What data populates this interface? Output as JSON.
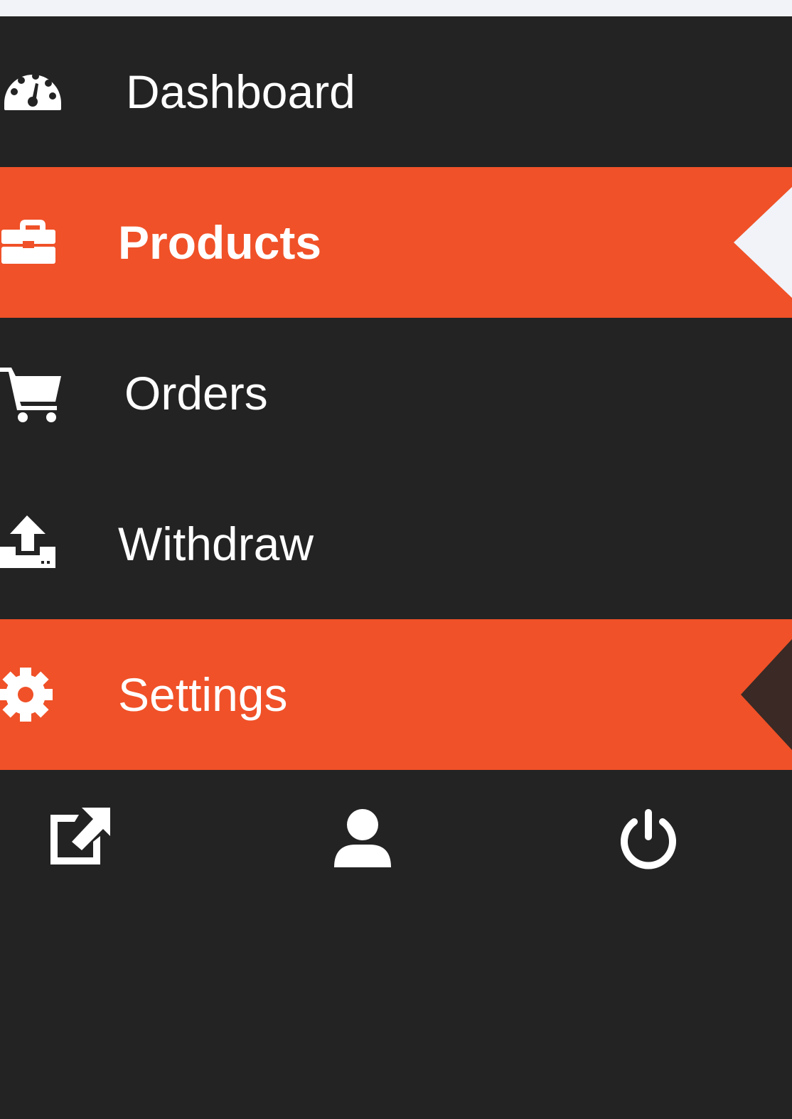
{
  "sidebar": {
    "items": [
      {
        "label": "Dashboard",
        "icon": "dashboard-gauge-icon",
        "active": false
      },
      {
        "label": "Products",
        "icon": "briefcase-icon",
        "active": true
      },
      {
        "label": "Orders",
        "icon": "shopping-cart-icon",
        "active": false
      },
      {
        "label": "Withdraw",
        "icon": "upload-icon",
        "active": false
      },
      {
        "label": "Settings",
        "icon": "gear-icon",
        "active": true
      }
    ]
  },
  "footer": {
    "icons": [
      "external-link-icon",
      "user-icon",
      "power-icon"
    ]
  },
  "colors": {
    "sidebar_bg": "#232323",
    "active_bg": "#f05128",
    "page_bg": "#f1f3f9",
    "text": "#ffffff"
  }
}
